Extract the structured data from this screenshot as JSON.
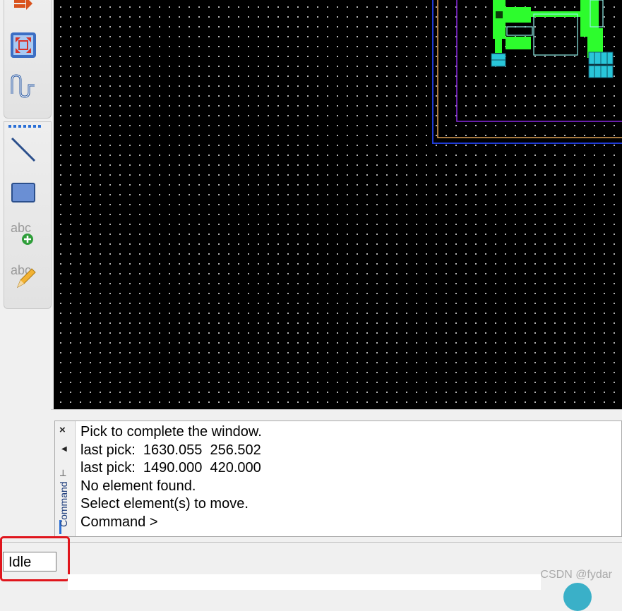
{
  "toolbar": {
    "tools": [
      {
        "name": "route-icon"
      },
      {
        "name": "fit-view-icon"
      },
      {
        "name": "wire-bend-icon"
      },
      {
        "name": "line-icon"
      },
      {
        "name": "rectangle-icon"
      },
      {
        "name": "add-text-icon"
      },
      {
        "name": "edit-text-icon"
      }
    ]
  },
  "command_panel": {
    "title": "Command",
    "close_label": "×",
    "lines": [
      "Pick to complete the window.",
      "last pick:  1630.055  256.502",
      "last pick:  1490.000  420.000",
      "No element found.",
      "Select element(s) to move.",
      "Command >"
    ]
  },
  "status": {
    "text": "Idle"
  },
  "watermark": "CSDN @fydar",
  "colors": {
    "canvas_bg": "#000000",
    "layout_green": "#2dfc2d",
    "layout_cyan": "#29c6d9",
    "boundary_blue": "#1f3bd6",
    "boundary_orange": "#e0a255",
    "boundary_purple": "#8a2be2",
    "highlight_red": "#e0151c"
  }
}
